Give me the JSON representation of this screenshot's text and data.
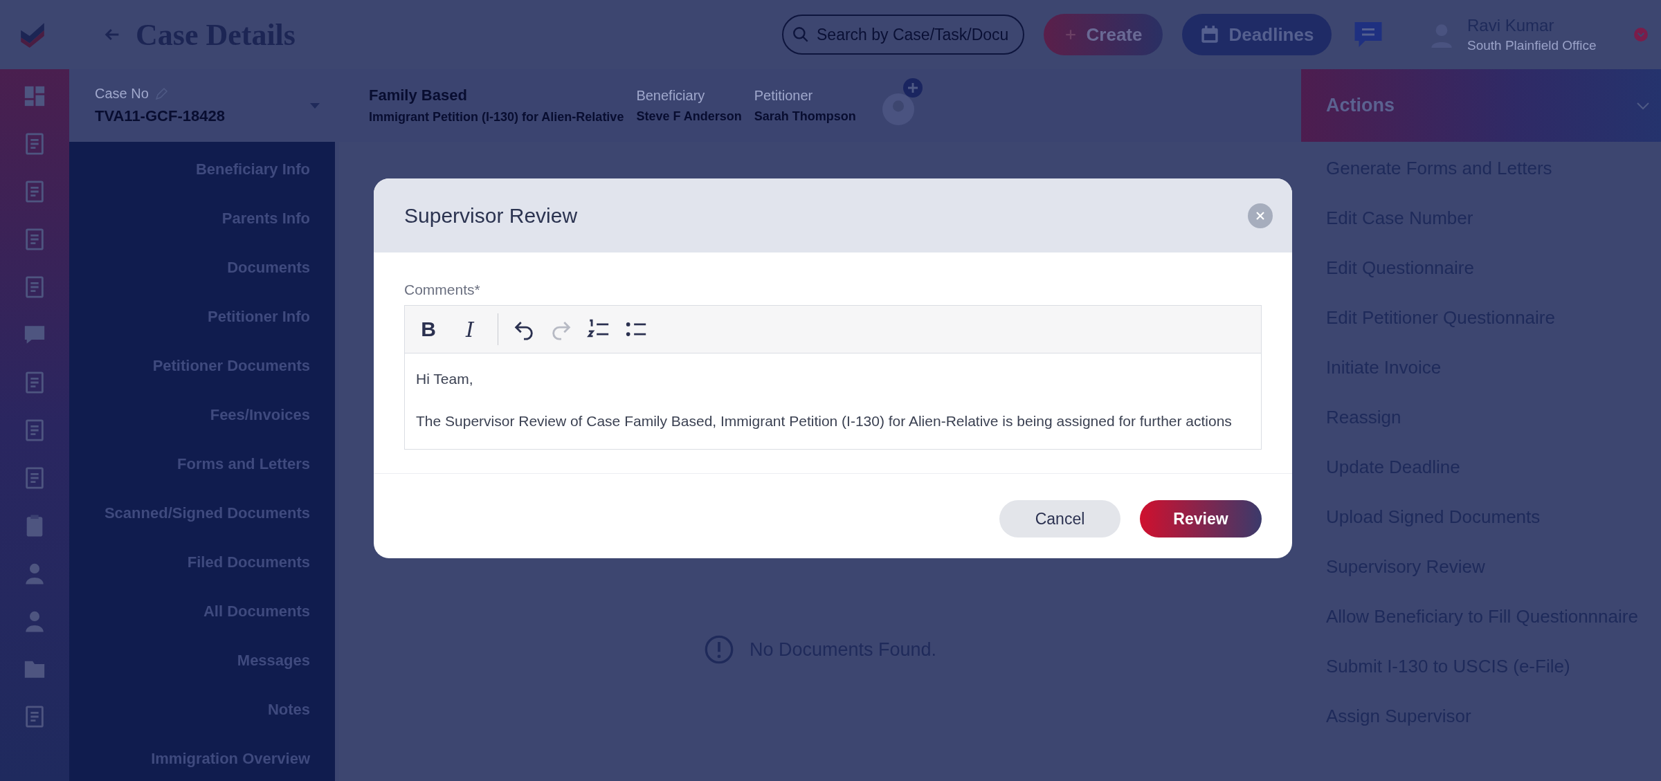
{
  "header": {
    "title": "Case Details",
    "search": {
      "placeholder": "Search by Case/Task/Docu"
    },
    "create_button": "Create",
    "deadlines_button": "Deadlines",
    "user": {
      "name": "Ravi Kumar",
      "office": "South Plainfield Office"
    }
  },
  "case_bar": {
    "case_no_label": "Case No",
    "case_no": "TVA11-GCF-18428",
    "case_type": "Family Based",
    "case_subtitle": "Immigrant Petition (I-130) for Alien-Relative",
    "beneficiary_label": "Beneficiary",
    "beneficiary": "Steve F Anderson",
    "petitioner_label": "Petitioner",
    "petitioner": "Sarah Thompson"
  },
  "sidebar": {
    "items": [
      "Beneficiary Info",
      "Parents Info",
      "Documents",
      "Petitioner Info",
      "Petitioner Documents",
      "Fees/Invoices",
      "Forms and Letters",
      "Scanned/Signed Documents",
      "Filed Documents",
      "All Documents",
      "Messages",
      "Notes",
      "Immigration Overview"
    ]
  },
  "main": {
    "empty_message": "No Documents Found."
  },
  "actions": {
    "title": "Actions",
    "items": [
      "Generate Forms and Letters",
      "Edit Case Number",
      "Edit Questionnaire",
      "Edit Petitioner Questionnaire",
      "Initiate Invoice",
      "Reassign",
      "Update Deadline",
      "Upload Signed Documents",
      "Supervisory Review",
      "Allow Beneficiary to Fill Questionnnaire",
      "Submit I-130 to USCIS (e-File)",
      "Assign Supervisor"
    ]
  },
  "modal": {
    "title": "Supervisor Review",
    "comments_label": "Comments*",
    "toolbar": [
      {
        "kind": "bold",
        "label": "B",
        "disabled": false
      },
      {
        "kind": "italic",
        "label": "I",
        "disabled": false
      },
      {
        "kind": "undo",
        "disabled": false
      },
      {
        "kind": "redo",
        "disabled": true
      },
      {
        "kind": "ordered-list",
        "disabled": false
      },
      {
        "kind": "bullet-list",
        "disabled": false
      }
    ],
    "comment_paragraphs": [
      "Hi Team,",
      "The Supervisor Review of Case Family Based, Immigrant Petition (I-130) for Alien-Relative is being assigned for further actions"
    ],
    "cancel_button": "Cancel",
    "review_button": "Review"
  }
}
